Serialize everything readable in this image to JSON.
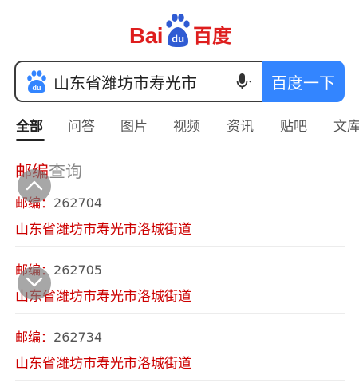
{
  "logo": {
    "bai": "Bai",
    "du": "du",
    "cn": "百度"
  },
  "search": {
    "query": "山东省潍坊市寿光市",
    "button_label": "百度一下"
  },
  "tabs": [
    {
      "label": "全部",
      "active": true
    },
    {
      "label": "问答",
      "active": false
    },
    {
      "label": "图片",
      "active": false
    },
    {
      "label": "视频",
      "active": false
    },
    {
      "label": "资讯",
      "active": false
    },
    {
      "label": "贴吧",
      "active": false
    },
    {
      "label": "文库",
      "active": false
    }
  ],
  "result": {
    "title_highlight": "邮编",
    "title_rest": "查询",
    "code_label": "邮编：",
    "records": [
      {
        "code": "262704",
        "address": "山东省潍坊市寿光市洛城街道"
      },
      {
        "code": "262705",
        "address": "山东省潍坊市寿光市洛城街道"
      },
      {
        "code": "262734",
        "address": "山东省潍坊市寿光市洛城街道"
      }
    ]
  },
  "colors": {
    "brand_red": "#de1e1e",
    "brand_blue": "#3385ff",
    "highlight_red": "#cc0000"
  },
  "icons": {
    "logo_paw": "paw-icon",
    "search_paw": "paw-icon",
    "mic": "microphone-icon",
    "scroll_up": "chevron-up-icon",
    "scroll_down": "chevron-down-icon"
  }
}
